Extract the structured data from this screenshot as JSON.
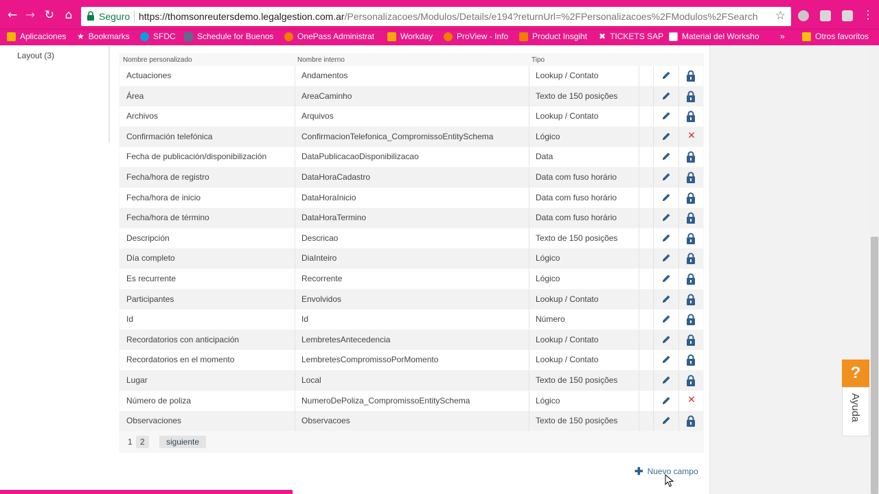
{
  "browser": {
    "secure_label": "Seguro",
    "url_host": "https://thomsonreutersdemo.legalgestion.com.ar",
    "url_path": "/Personalizacoes/Modulos/Details/e194?returnUrl=%2FPersonalizacoes%2FModulos%2FSearch",
    "bookmarks": [
      "Aplicaciones",
      "Bookmarks",
      "SFDC",
      "Schedule for Buenos",
      "OnePass Administrat",
      "Workday",
      "ProView - Info",
      "Product Insgiht",
      "TICKETS SAP",
      "Material del Worksho",
      "»",
      "Otros favoritos"
    ]
  },
  "sidebar": {
    "layout_link": "Layout (3)"
  },
  "table": {
    "headers": {
      "name": "Nombre personalizado",
      "internal": "Nombre interno",
      "type": "Tipo"
    },
    "rows": [
      {
        "name": "Actuaciones",
        "internal": "Andamentos",
        "type": "Lookup / Contato",
        "locked": true
      },
      {
        "name": "Área",
        "internal": "AreaCaminho",
        "type": "Texto de 150 posições",
        "locked": true
      },
      {
        "name": "Archivos",
        "internal": "Arquivos",
        "type": "Lookup / Contato",
        "locked": true
      },
      {
        "name": "Confirmación telefónica",
        "internal": "ConfirmacionTelefonica_CompromissoEntitySchema",
        "type": "Lógico",
        "locked": false
      },
      {
        "name": "Fecha de publicación/disponibilización",
        "internal": "DataPublicacaoDisponibilizacao",
        "type": "Data",
        "locked": true
      },
      {
        "name": "Fecha/hora de registro",
        "internal": "DataHoraCadastro",
        "type": "Data com fuso horário",
        "locked": true
      },
      {
        "name": "Fecha/hora de inicio",
        "internal": "DataHoraInicio",
        "type": "Data com fuso horário",
        "locked": true
      },
      {
        "name": "Fecha/hora de término",
        "internal": "DataHoraTermino",
        "type": "Data com fuso horário",
        "locked": true
      },
      {
        "name": "Descripción",
        "internal": "Descricao",
        "type": "Texto de 150 posições",
        "locked": true
      },
      {
        "name": "Día completo",
        "internal": "DiaInteiro",
        "type": "Lógico",
        "locked": true
      },
      {
        "name": "Es recurrente",
        "internal": "Recorrente",
        "type": "Lógico",
        "locked": true
      },
      {
        "name": "Participantes",
        "internal": "Envolvidos",
        "type": "Lookup / Contato",
        "locked": true
      },
      {
        "name": "Id",
        "internal": "Id",
        "type": "Número",
        "locked": true
      },
      {
        "name": "Recordatorios con anticipación",
        "internal": "LembretesAntecedencia",
        "type": "Lookup / Contato",
        "locked": true
      },
      {
        "name": "Recordatorios en el momento",
        "internal": "LembretesCompromissoPorMomento",
        "type": "Lookup / Contato",
        "locked": true
      },
      {
        "name": "Lugar",
        "internal": "Local",
        "type": "Texto de 150 posições",
        "locked": true
      },
      {
        "name": "Número de poliza",
        "internal": "NumeroDePoliza_CompromissoEntitySchema",
        "type": "Lógico",
        "locked": false
      },
      {
        "name": "Observaciones",
        "internal": "Observacoes",
        "type": "Texto de 150 posições",
        "locked": true
      }
    ]
  },
  "pagination": {
    "current": "1",
    "page2": "2",
    "next": "siguiente"
  },
  "actions": {
    "new_field": "Nuevo campo"
  },
  "help": {
    "question": "?",
    "label": "Ayuda"
  }
}
